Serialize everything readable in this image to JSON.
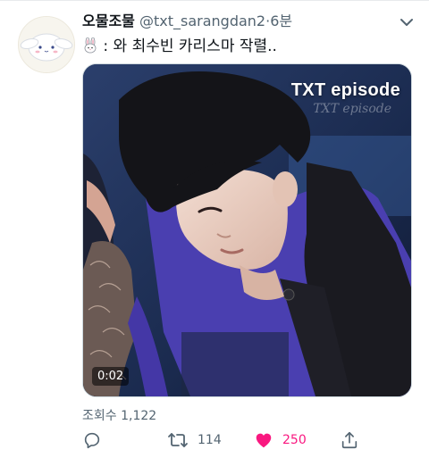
{
  "tweet": {
    "author": {
      "display_name": "오물조물",
      "handle": "@txt_sarangdan2",
      "separator": "·",
      "time": "6분",
      "avatar_icon": "cinnamoroll-avatar-icon"
    },
    "text": ": 와 최수빈 카리스마 작렬..",
    "emoji_icon": "bunny-emoji-icon",
    "media": {
      "overlay_title": "TXT episode",
      "overlay_watermark": "TXT episode",
      "duration": "0:02"
    },
    "views_label": "조회수 1,122",
    "actions": {
      "reply_count": "",
      "retweet_count": "114",
      "like_count": "250",
      "liked": true
    }
  },
  "colors": {
    "text_primary": "#0f1419",
    "text_secondary": "#536471",
    "like_pink": "#f91880",
    "border": "#cfd9de"
  }
}
